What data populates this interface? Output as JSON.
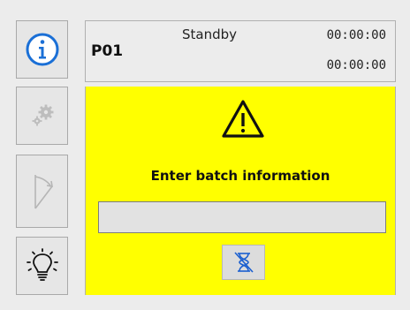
{
  "header": {
    "program": "P01",
    "status": "Standby",
    "time_elapsed": "00:00:00",
    "time_remaining": "00:00:00"
  },
  "prompt": {
    "message": "Enter batch information",
    "input_value": "",
    "background_color": "#ffff00"
  },
  "sidebar": {
    "items": [
      {
        "icon": "info-icon",
        "state": "enabled"
      },
      {
        "icon": "gears-icon",
        "state": "disabled"
      },
      {
        "icon": "filter-icon",
        "state": "disabled"
      },
      {
        "icon": "lightbulb-icon",
        "state": "enabled"
      }
    ]
  },
  "colors": {
    "accent_blue": "#1a6fd6",
    "disabled_gray": "#b5b5b5"
  }
}
